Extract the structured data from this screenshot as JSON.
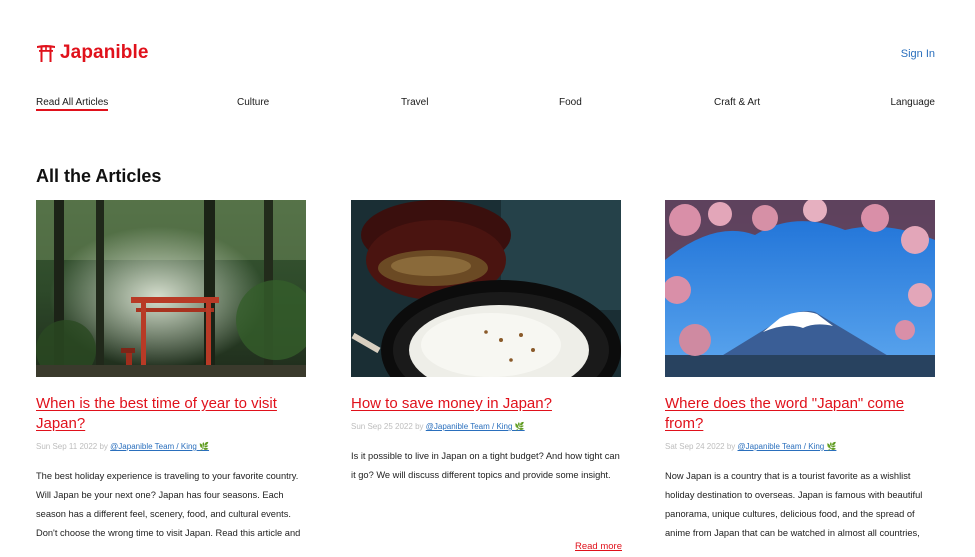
{
  "brand": {
    "name": "Japanible",
    "color": "#e0111b"
  },
  "header": {
    "signin_label": "Sign In"
  },
  "nav": {
    "items": [
      {
        "label": "Read All Articles",
        "active": true
      },
      {
        "label": "Culture"
      },
      {
        "label": "Travel"
      },
      {
        "label": "Food"
      },
      {
        "label": "Craft & Art"
      },
      {
        "label": "Language"
      }
    ]
  },
  "main": {
    "section_title": "All the Articles",
    "articles": [
      {
        "title": "When is the best time of year to visit Japan?",
        "date": "Sun Sep 11 2022",
        "by": "by",
        "author": "@Japanible Team / King 🌿",
        "excerpt": "The best holiday experience is traveling to your favorite country. Will Japan be your next one? Japan has four seasons. Each season has a different feel, scenery, food, and cultural events. Don't choose the wrong time to visit Japan. Read this article and",
        "image": "torii-forest"
      },
      {
        "title": "How to save money in Japan?",
        "date": "Sun Sep 25 2022",
        "by": "by",
        "author": "@Japanible Team / King 🌿",
        "excerpt": "Is it possible to live in Japan on a tight budget? And how tight can it go? We will discuss different topics and provide some insight.",
        "read_more": "Read more",
        "image": "rice-bowl"
      },
      {
        "title": "Where does the word \"Japan\" come from?",
        "date": "Sat Sep 24 2022",
        "by": "by",
        "author": "@Japanible Team / King 🌿",
        "excerpt": "Now Japan is a country that is a tourist favorite as a wishlist holiday destination to overseas. Japan is famous with beautiful panorama, unique cultures, delicious food, and the spread of anime from Japan that can be watched in almost all countries,",
        "image": "mount-fuji-sakura"
      }
    ]
  }
}
